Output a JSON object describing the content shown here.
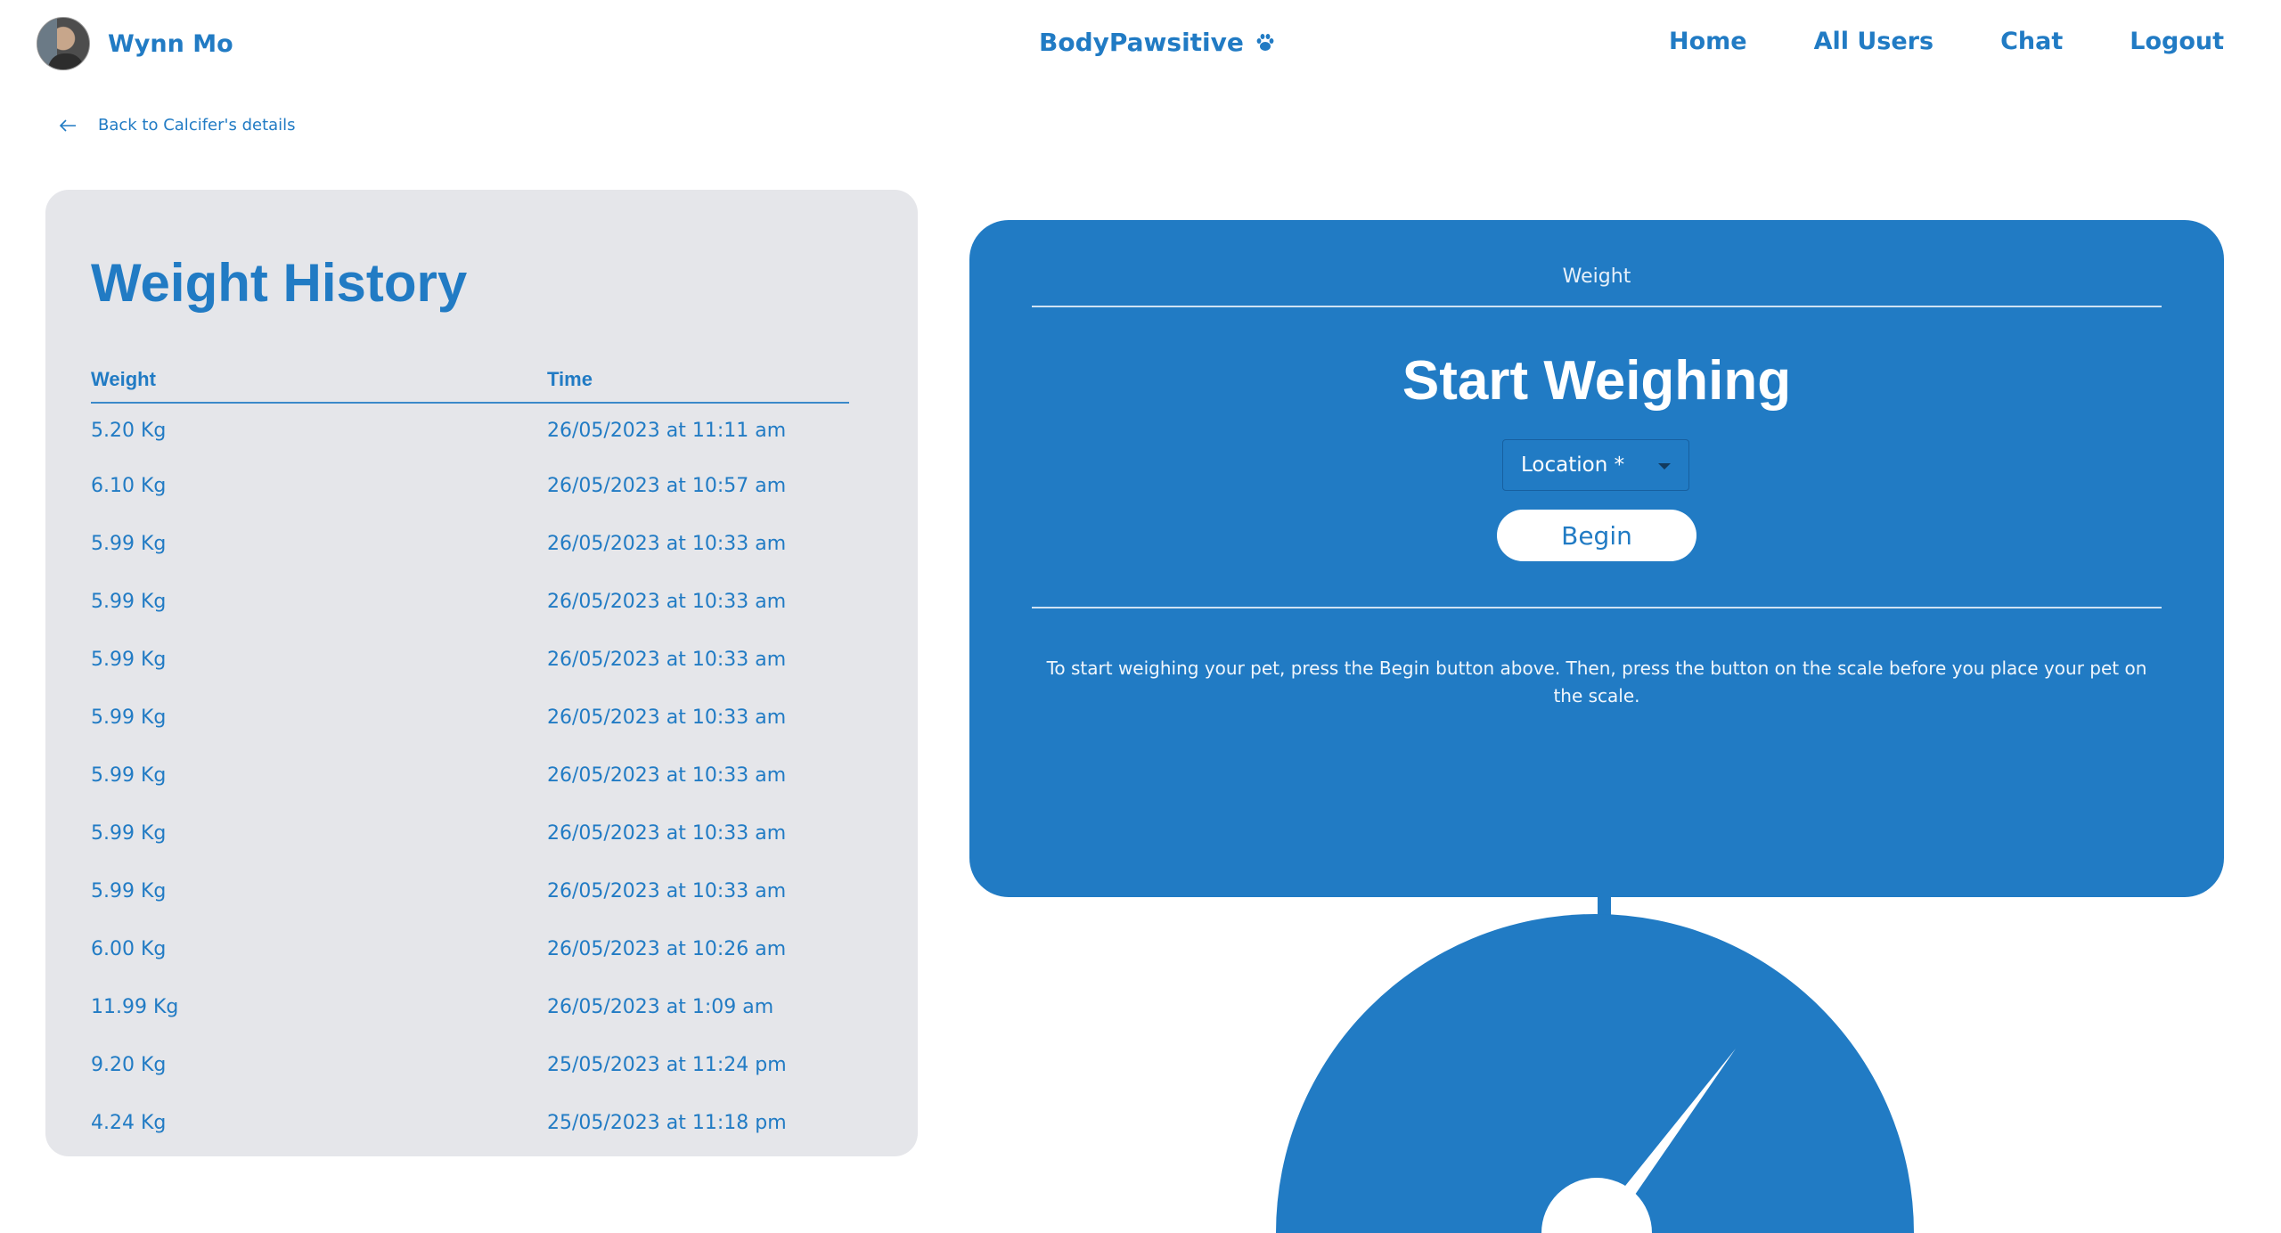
{
  "header": {
    "user_name": "Wynn Mo",
    "brand": "BodyPawsitive",
    "nav": [
      "Home",
      "All Users",
      "Chat",
      "Logout"
    ]
  },
  "back_link": "Back to Calcifer's details",
  "history": {
    "title": "Weight History",
    "columns": [
      "Weight",
      "Time"
    ],
    "rows": [
      {
        "weight": "5.20 Kg",
        "time": "26/05/2023 at 11:11 am"
      },
      {
        "weight": "6.10 Kg",
        "time": "26/05/2023 at 10:57 am"
      },
      {
        "weight": "5.99 Kg",
        "time": "26/05/2023 at 10:33 am"
      },
      {
        "weight": "5.99 Kg",
        "time": "26/05/2023 at 10:33 am"
      },
      {
        "weight": "5.99 Kg",
        "time": "26/05/2023 at 10:33 am"
      },
      {
        "weight": "5.99 Kg",
        "time": "26/05/2023 at 10:33 am"
      },
      {
        "weight": "5.99 Kg",
        "time": "26/05/2023 at 10:33 am"
      },
      {
        "weight": "5.99 Kg",
        "time": "26/05/2023 at 10:33 am"
      },
      {
        "weight": "5.99 Kg",
        "time": "26/05/2023 at 10:33 am"
      },
      {
        "weight": "6.00 Kg",
        "time": "26/05/2023 at 10:26 am"
      },
      {
        "weight": "11.99 Kg",
        "time": "26/05/2023 at 1:09 am"
      },
      {
        "weight": "9.20 Kg",
        "time": "25/05/2023 at 11:24 pm"
      },
      {
        "weight": "4.24 Kg",
        "time": "25/05/2023 at 11:18 pm"
      }
    ]
  },
  "weigh": {
    "label": "Weight",
    "title": "Start Weighing",
    "location_label": "Location *",
    "begin_label": "Begin",
    "instructions": "To start weighing your pet, press the Begin button above. Then, press the button on the scale before you place your pet on the scale."
  },
  "colors": {
    "primary": "#217bc4",
    "panel_bg": "#e5e6ea",
    "white": "#ffffff"
  },
  "icons": {
    "brand": "paw-icon",
    "back": "arrow-left-icon",
    "select": "caret-down-icon"
  }
}
